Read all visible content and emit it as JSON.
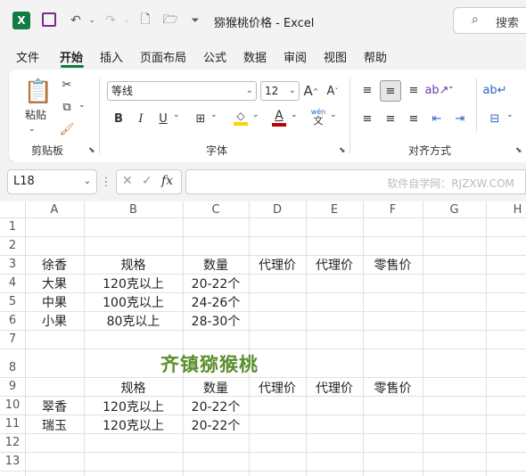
{
  "titlebar": {
    "title": "猕猴桃价格 - Excel",
    "search_label": "搜索",
    "app_logo": "X"
  },
  "menu": [
    "文件",
    "开始",
    "插入",
    "页面布局",
    "公式",
    "数据",
    "审阅",
    "视图",
    "帮助"
  ],
  "ribbon": {
    "clipboard": {
      "paste_label": "粘贴",
      "group_label": "剪贴板"
    },
    "font": {
      "font_name": "等线",
      "font_size": "12",
      "group_label": "字体",
      "phonetic_top": "wén",
      "phonetic_bottom": "文"
    },
    "alignment": {
      "group_label": "对齐方式"
    },
    "accent_color": "#107c41",
    "highlight_color": "#ffd400",
    "font_color": "#c00000"
  },
  "formula_bar": {
    "name_box": "L18",
    "formula": "",
    "watermark": "软件自学网：RJZXW.COM"
  },
  "sheet": {
    "columns": [
      "A",
      "B",
      "C",
      "D",
      "E",
      "F",
      "G",
      "H"
    ],
    "rows": [
      "1",
      "2",
      "3",
      "4",
      "5",
      "6",
      "7",
      "8",
      "9",
      "10",
      "11",
      "12",
      "13"
    ],
    "title": "齐镇猕猴桃",
    "title_color": "#5a8f2d",
    "table1": {
      "headers": [
        "徐香",
        "规格",
        "数量",
        "代理价",
        "代理价",
        "零售价"
      ],
      "rows": [
        [
          "大果",
          "120克以上",
          "20-22个"
        ],
        [
          "中果",
          "100克以上",
          "24-26个"
        ],
        [
          "小果",
          "80克以上",
          "28-30个"
        ]
      ]
    },
    "table2": {
      "headers": [
        "",
        "规格",
        "数量",
        "代理价",
        "代理价",
        "零售价"
      ],
      "rows": [
        [
          "翠香",
          "120克以上",
          "20-22个"
        ],
        [
          "瑞玉",
          "120克以上",
          "20-22个"
        ]
      ]
    }
  }
}
